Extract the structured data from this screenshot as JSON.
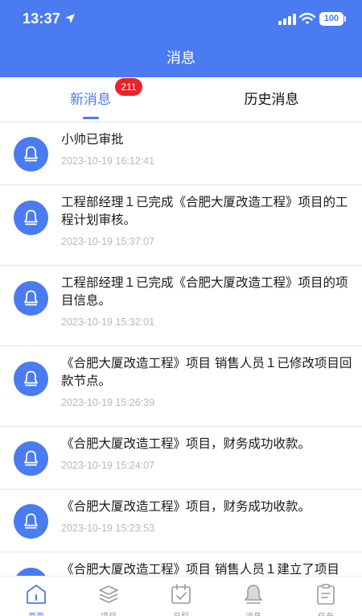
{
  "status_bar": {
    "time": "13:37",
    "battery": "100"
  },
  "header": {
    "title": "消息"
  },
  "tabs": [
    {
      "label": "新消息",
      "active": true,
      "badge": "211"
    },
    {
      "label": "历史消息",
      "active": false
    }
  ],
  "messages": [
    {
      "text": "小帅已审批",
      "time": "2023-10-19 16:12:41",
      "icon": "bell-icon"
    },
    {
      "text": "工程部经理１已完成《合肥大厦改造工程》项目的工程计划审核。",
      "time": "2023-10-19 15:37:07",
      "icon": "bell-icon"
    },
    {
      "text": "工程部经理１已完成《合肥大厦改造工程》项目的项目信息。",
      "time": "2023-10-19 15:32:01",
      "icon": "bell-icon"
    },
    {
      "text": "《合肥大厦改造工程》项目 销售人员１已修改项目回款节点。",
      "time": "2023-10-19 15:26:39",
      "icon": "bell-icon"
    },
    {
      "text": "《合肥大厦改造工程》项目，财务成功收款。",
      "time": "2023-10-19 15:24:07",
      "icon": "bell-icon"
    },
    {
      "text": "《合肥大厦改造工程》项目，财务成功收款。",
      "time": "2023-10-19 15:23:53",
      "icon": "bell-icon"
    },
    {
      "text": "《合肥大厦改造工程》项目 销售人员１建立了项目",
      "time": "",
      "icon": "bell-icon"
    }
  ],
  "bottom_nav": [
    {
      "label": "首页",
      "icon": "home-icon",
      "active": true
    },
    {
      "label": "项目",
      "icon": "layers-icon",
      "active": false
    },
    {
      "label": "日程",
      "icon": "calendar-icon",
      "active": false
    },
    {
      "label": "消息",
      "icon": "bell-icon",
      "active": false
    },
    {
      "label": "任务",
      "icon": "clipboard-icon",
      "active": false
    }
  ],
  "colors": {
    "primary": "#4a7bf0",
    "badge": "#e8232a",
    "timestamp": "#b9b9b9",
    "nav_inactive": "#9a9a9a"
  }
}
